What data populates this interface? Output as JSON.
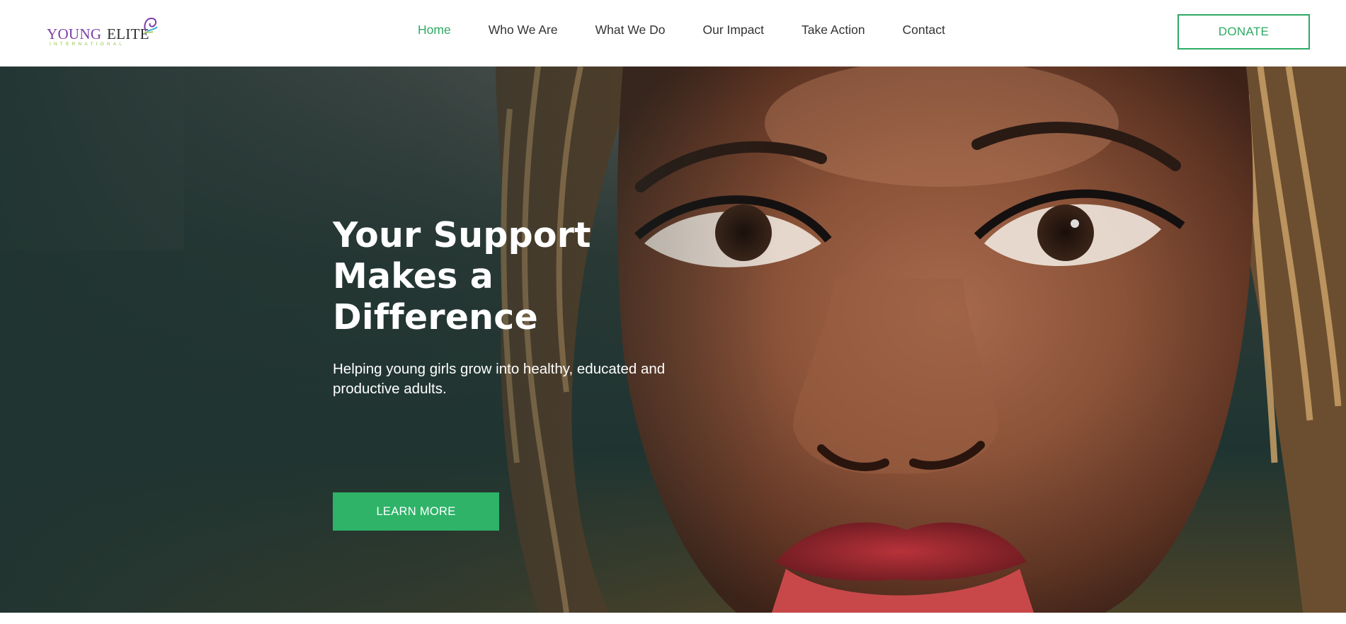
{
  "header": {
    "logo": {
      "word1": "YOUNG",
      "word2": "ELITE",
      "tagline": "INTERNATIONAL"
    },
    "nav": [
      {
        "label": "Home",
        "active": true
      },
      {
        "label": "Who We Are",
        "active": false
      },
      {
        "label": "What We Do",
        "active": false
      },
      {
        "label": "Our Impact",
        "active": false
      },
      {
        "label": "Take Action",
        "active": false
      },
      {
        "label": "Contact",
        "active": false
      }
    ],
    "donate_label": "DONATE"
  },
  "hero": {
    "title": "Your Support Makes a Difference",
    "subtitle": "Helping young girls grow into healthy, educated and productive adults.",
    "cta_label": "LEARN MORE"
  },
  "colors": {
    "accent": "#2eaa64",
    "cta": "#2eb368",
    "logo_purple": "#7a3fa8",
    "logo_green": "#8cc63f",
    "nav_text": "#333333"
  }
}
